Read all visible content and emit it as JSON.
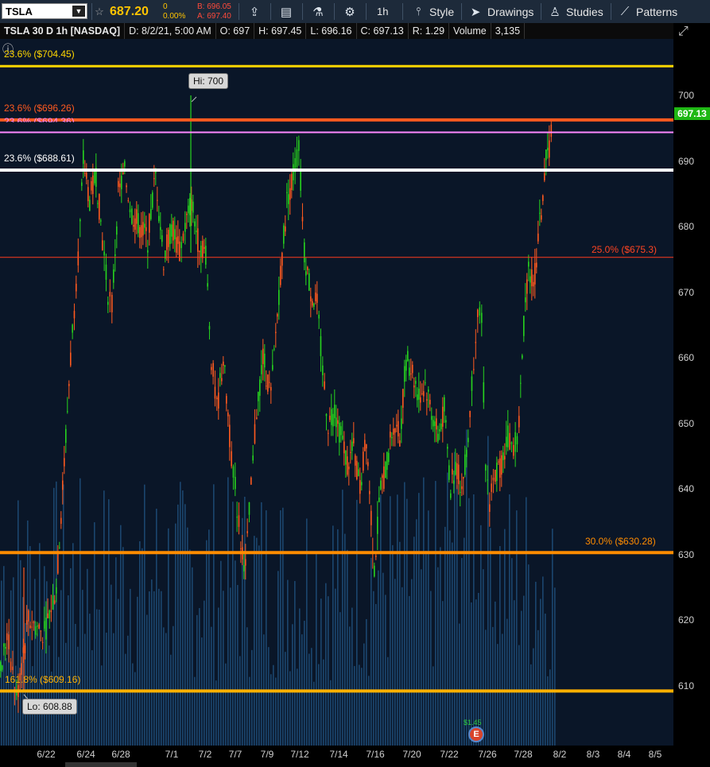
{
  "toolbar": {
    "symbol": "TSLA",
    "last_price": "687.20",
    "change": "0",
    "change_pct": "0.00%",
    "bid": "B: 696.05",
    "ask": "A: 697.40",
    "timeframe": "1h",
    "style_label": "Style",
    "drawings_label": "Drawings",
    "studies_label": "Studies",
    "patterns_label": "Patterns"
  },
  "infobar": {
    "title": "TSLA 30 D 1h [NASDAQ]",
    "date": "D: 8/2/21, 5:00 AM",
    "open": "O: 697",
    "high": "H: 697.45",
    "low": "L: 696.16",
    "close": "C: 697.13",
    "range": "R: 1.29",
    "volume_label": "Volume",
    "volume_value": "3,135"
  },
  "y_ticks": [
    "700",
    "690",
    "680",
    "670",
    "660",
    "650",
    "640",
    "630",
    "620",
    "610"
  ],
  "x_ticks": [
    "6/22",
    "6/24",
    "6/28",
    "7/1",
    "7/2",
    "7/7",
    "7/9",
    "7/12",
    "7/14",
    "7/16",
    "7/20",
    "7/22",
    "7/26",
    "7/28",
    "8/2",
    "8/3",
    "8/4",
    "8/5"
  ],
  "levels": {
    "fib_704": {
      "label": "23.6% ($704.45)",
      "color": "#ffd700"
    },
    "fib_696": {
      "label": "23.6% ($696.26)",
      "color": "#ff5a1f"
    },
    "fib_694": {
      "label": "23.6% ($694.36)",
      "color": "#ff88ff"
    },
    "fib_688": {
      "label": "23.6% ($688.61)",
      "color": "#ffffff"
    },
    "fib_675": {
      "label": "25.0%  ($675.3)",
      "color": "#ff4422"
    },
    "fib_630": {
      "label": "30.0%  ($630.28)",
      "color": "#ff8c00"
    },
    "fib_609": {
      "label": "161.8%  ($609.16)",
      "color": "#ffb000"
    }
  },
  "bubbles": {
    "high": "Hi: 700",
    "low": "Lo: 608.88"
  },
  "price_tag": "697.13",
  "earnings_marker": {
    "dollar": "$1.45",
    "glyph": "E"
  },
  "chart_data": {
    "type": "candlestick",
    "x_range": [
      "6/21",
      "8/5"
    ],
    "ylim": [
      602,
      707
    ],
    "series": [
      {
        "name": "close",
        "x": [
          "6/22",
          "6/24",
          "6/28",
          "7/1",
          "7/2",
          "7/7",
          "7/9",
          "7/12",
          "7/14",
          "7/16",
          "7/20",
          "7/22",
          "7/26",
          "7/28",
          "8/2"
        ],
        "values": [
          621,
          683,
          670,
          676,
          673,
          630,
          655,
          684,
          648,
          627,
          660,
          640,
          645,
          670,
          697
        ]
      }
    ]
  }
}
